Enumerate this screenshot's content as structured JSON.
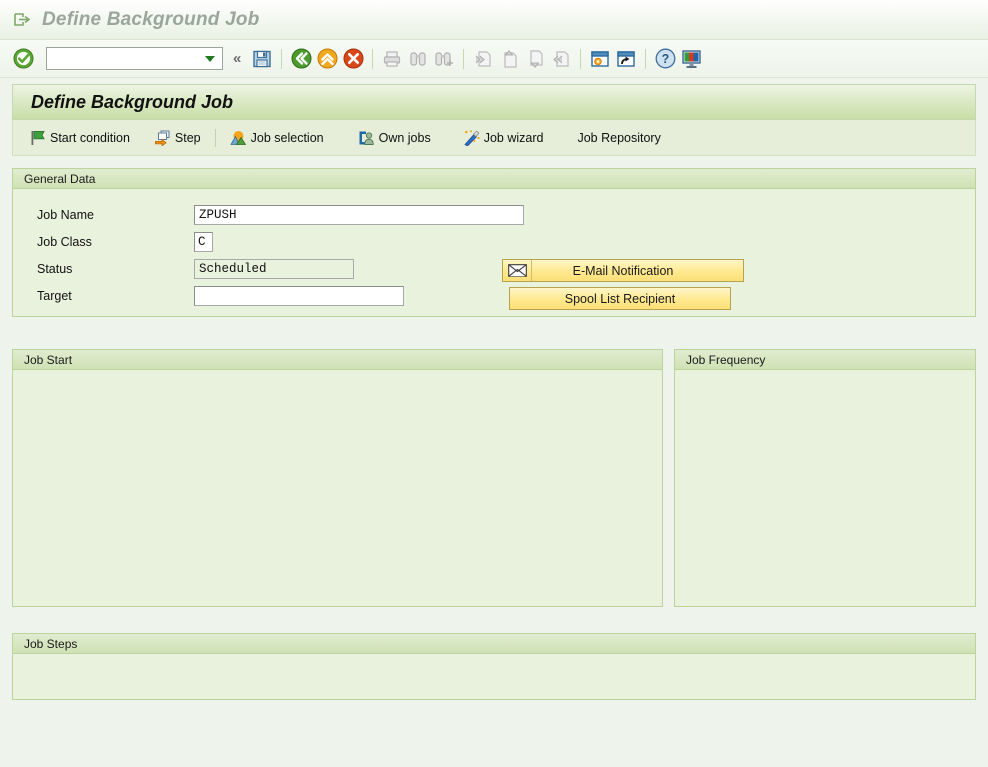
{
  "window": {
    "title": "Define Background Job",
    "icon": "exit-arrow-icon"
  },
  "system_toolbar": {
    "enter_icon": "green-check-circle-icon",
    "command_field": {
      "value": "",
      "placeholder": "",
      "dropdown_icon": "chevron-down-icon"
    },
    "collapse_icon": "double-chevron-left-icon",
    "buttons": [
      {
        "name": "save-button",
        "icon": "floppy-disk-icon",
        "tooltip": "Save",
        "enabled": true
      },
      {
        "name": "back-button",
        "icon": "green-back-arrow-icon",
        "tooltip": "Back",
        "enabled": true
      },
      {
        "name": "exit-button",
        "icon": "yellow-up-arrow-icon",
        "tooltip": "Exit",
        "enabled": true
      },
      {
        "name": "cancel-button",
        "icon": "red-x-circle-icon",
        "tooltip": "Cancel",
        "enabled": true
      },
      {
        "name": "print-button",
        "icon": "printer-icon",
        "tooltip": "Print",
        "enabled": false
      },
      {
        "name": "find-button",
        "icon": "binoculars-icon",
        "tooltip": "Find",
        "enabled": false
      },
      {
        "name": "find-next-button",
        "icon": "binoculars-plus-icon",
        "tooltip": "Find Next",
        "enabled": false
      },
      {
        "name": "first-page-button",
        "icon": "first-page-icon",
        "tooltip": "First Page",
        "enabled": false
      },
      {
        "name": "previous-page-button",
        "icon": "previous-page-icon",
        "tooltip": "Previous Page",
        "enabled": false
      },
      {
        "name": "next-page-button",
        "icon": "next-page-icon",
        "tooltip": "Next Page",
        "enabled": false
      },
      {
        "name": "last-page-button",
        "icon": "last-page-icon",
        "tooltip": "Last Page",
        "enabled": false
      },
      {
        "name": "create-session-button",
        "icon": "new-session-window-icon",
        "tooltip": "Create New Session",
        "enabled": true
      },
      {
        "name": "create-shortcut-button",
        "icon": "shortcut-window-icon",
        "tooltip": "Create Shortcut",
        "enabled": true
      },
      {
        "name": "help-button",
        "icon": "question-mark-circle-icon",
        "tooltip": "Help",
        "enabled": true
      },
      {
        "name": "customize-layout-button",
        "icon": "monitor-icon",
        "tooltip": "Customize Local Layout",
        "enabled": true
      }
    ]
  },
  "app": {
    "title": "Define Background Job",
    "toolbar": [
      {
        "name": "start-condition-button",
        "label": "Start condition",
        "icon": "green-flag-icon"
      },
      {
        "name": "step-button",
        "label": "Step",
        "icon": "step-arrow-icon"
      },
      {
        "name": "job-selection-button",
        "label": "Job selection",
        "icon": "mountain-sunrise-icon"
      },
      {
        "name": "own-jobs-button",
        "label": "Own jobs",
        "icon": "own-jobs-person-icon"
      },
      {
        "name": "job-wizard-button",
        "label": "Job wizard",
        "icon": "magic-wand-icon"
      },
      {
        "name": "job-repository-button",
        "label": "Job Repository",
        "icon": ""
      }
    ]
  },
  "general_data": {
    "header": "General Data",
    "fields": [
      {
        "name": "job-name",
        "label": "Job Name",
        "value": "ZPUSH",
        "readonly": false
      },
      {
        "name": "job-class",
        "label": "Job Class",
        "value": "C",
        "readonly": false
      },
      {
        "name": "status",
        "label": "Status",
        "value": "Scheduled",
        "readonly": true
      },
      {
        "name": "target",
        "label": "Target",
        "value": "",
        "readonly": false
      }
    ],
    "email_notification_label": "E-Mail Notification",
    "email_notification_icon": "envelope-icon",
    "spool_list_recipient_label": "Spool List Recipient"
  },
  "job_start": {
    "header": "Job Start",
    "content": ""
  },
  "job_frequency": {
    "header": "Job Frequency",
    "content": ""
  },
  "job_steps": {
    "header": "Job Steps",
    "content": ""
  },
  "colors": {
    "page_background": "#eef4ec",
    "panel_background": "#e9f2dd",
    "panel_header_top": "#e0ecd0",
    "panel_header_bottom": "#cfe2b5",
    "panel_border": "#bcd39b",
    "app_title_band_bottom": "#c8dea6",
    "app_toolbar_background": "#e6eed9",
    "button_yellow": "#ffe98f",
    "button_yellow_border": "#b9a24e",
    "window_title_text": "#9aa69a"
  }
}
